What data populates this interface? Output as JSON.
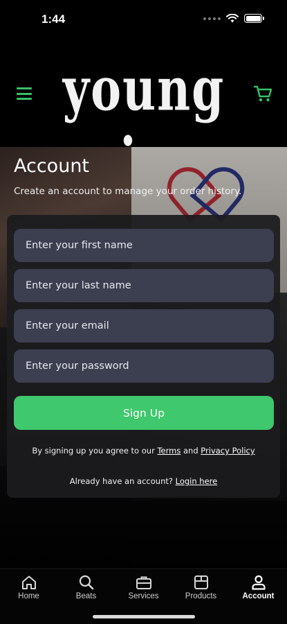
{
  "status_bar": {
    "time": "1:44"
  },
  "header": {
    "logo_text": "young sixx"
  },
  "page": {
    "title": "Account",
    "subtitle": "Create an account to manage your order history."
  },
  "form": {
    "first_name_placeholder": "Enter your first name",
    "last_name_placeholder": "Enter your last name",
    "email_placeholder": "Enter your email",
    "password_placeholder": "Enter your password",
    "signup_label": "Sign Up",
    "agree_prefix": "By signing up you agree to our ",
    "terms_label": "Terms",
    "agree_and": " and ",
    "privacy_label": "Privacy Policy",
    "login_prefix": "Already have an account? ",
    "login_label": "Login here"
  },
  "tabs": [
    {
      "label": "Home",
      "icon": "home-icon"
    },
    {
      "label": "Beats",
      "icon": "search-icon"
    },
    {
      "label": "Services",
      "icon": "briefcase-icon"
    },
    {
      "label": "Products",
      "icon": "box-icon"
    },
    {
      "label": "Account",
      "icon": "user-icon",
      "active": true
    }
  ],
  "colors": {
    "accent": "#3fc86d",
    "field_bg": "#3b3f50",
    "panel_bg": "#1c1c1e"
  }
}
